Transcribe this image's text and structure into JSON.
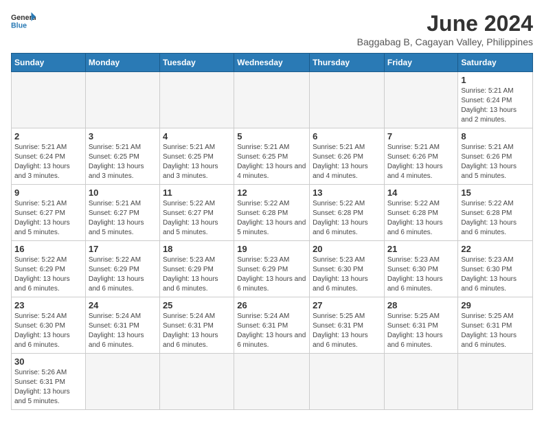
{
  "logo": {
    "text_general": "General",
    "text_blue": "Blue"
  },
  "header": {
    "title": "June 2024",
    "subtitle": "Baggabag B, Cagayan Valley, Philippines"
  },
  "weekdays": [
    "Sunday",
    "Monday",
    "Tuesday",
    "Wednesday",
    "Thursday",
    "Friday",
    "Saturday"
  ],
  "weeks": [
    [
      {
        "day": "",
        "info": "",
        "empty": true
      },
      {
        "day": "",
        "info": "",
        "empty": true
      },
      {
        "day": "",
        "info": "",
        "empty": true
      },
      {
        "day": "",
        "info": "",
        "empty": true
      },
      {
        "day": "",
        "info": "",
        "empty": true
      },
      {
        "day": "",
        "info": "",
        "empty": true
      },
      {
        "day": "1",
        "info": "Sunrise: 5:21 AM\nSunset: 6:24 PM\nDaylight: 13 hours and 2 minutes.",
        "empty": false
      }
    ],
    [
      {
        "day": "2",
        "info": "Sunrise: 5:21 AM\nSunset: 6:24 PM\nDaylight: 13 hours and 3 minutes.",
        "empty": false
      },
      {
        "day": "3",
        "info": "Sunrise: 5:21 AM\nSunset: 6:25 PM\nDaylight: 13 hours and 3 minutes.",
        "empty": false
      },
      {
        "day": "4",
        "info": "Sunrise: 5:21 AM\nSunset: 6:25 PM\nDaylight: 13 hours and 3 minutes.",
        "empty": false
      },
      {
        "day": "5",
        "info": "Sunrise: 5:21 AM\nSunset: 6:25 PM\nDaylight: 13 hours and 4 minutes.",
        "empty": false
      },
      {
        "day": "6",
        "info": "Sunrise: 5:21 AM\nSunset: 6:26 PM\nDaylight: 13 hours and 4 minutes.",
        "empty": false
      },
      {
        "day": "7",
        "info": "Sunrise: 5:21 AM\nSunset: 6:26 PM\nDaylight: 13 hours and 4 minutes.",
        "empty": false
      },
      {
        "day": "8",
        "info": "Sunrise: 5:21 AM\nSunset: 6:26 PM\nDaylight: 13 hours and 5 minutes.",
        "empty": false
      }
    ],
    [
      {
        "day": "9",
        "info": "Sunrise: 5:21 AM\nSunset: 6:27 PM\nDaylight: 13 hours and 5 minutes.",
        "empty": false
      },
      {
        "day": "10",
        "info": "Sunrise: 5:21 AM\nSunset: 6:27 PM\nDaylight: 13 hours and 5 minutes.",
        "empty": false
      },
      {
        "day": "11",
        "info": "Sunrise: 5:22 AM\nSunset: 6:27 PM\nDaylight: 13 hours and 5 minutes.",
        "empty": false
      },
      {
        "day": "12",
        "info": "Sunrise: 5:22 AM\nSunset: 6:28 PM\nDaylight: 13 hours and 5 minutes.",
        "empty": false
      },
      {
        "day": "13",
        "info": "Sunrise: 5:22 AM\nSunset: 6:28 PM\nDaylight: 13 hours and 6 minutes.",
        "empty": false
      },
      {
        "day": "14",
        "info": "Sunrise: 5:22 AM\nSunset: 6:28 PM\nDaylight: 13 hours and 6 minutes.",
        "empty": false
      },
      {
        "day": "15",
        "info": "Sunrise: 5:22 AM\nSunset: 6:28 PM\nDaylight: 13 hours and 6 minutes.",
        "empty": false
      }
    ],
    [
      {
        "day": "16",
        "info": "Sunrise: 5:22 AM\nSunset: 6:29 PM\nDaylight: 13 hours and 6 minutes.",
        "empty": false
      },
      {
        "day": "17",
        "info": "Sunrise: 5:22 AM\nSunset: 6:29 PM\nDaylight: 13 hours and 6 minutes.",
        "empty": false
      },
      {
        "day": "18",
        "info": "Sunrise: 5:23 AM\nSunset: 6:29 PM\nDaylight: 13 hours and 6 minutes.",
        "empty": false
      },
      {
        "day": "19",
        "info": "Sunrise: 5:23 AM\nSunset: 6:29 PM\nDaylight: 13 hours and 6 minutes.",
        "empty": false
      },
      {
        "day": "20",
        "info": "Sunrise: 5:23 AM\nSunset: 6:30 PM\nDaylight: 13 hours and 6 minutes.",
        "empty": false
      },
      {
        "day": "21",
        "info": "Sunrise: 5:23 AM\nSunset: 6:30 PM\nDaylight: 13 hours and 6 minutes.",
        "empty": false
      },
      {
        "day": "22",
        "info": "Sunrise: 5:23 AM\nSunset: 6:30 PM\nDaylight: 13 hours and 6 minutes.",
        "empty": false
      }
    ],
    [
      {
        "day": "23",
        "info": "Sunrise: 5:24 AM\nSunset: 6:30 PM\nDaylight: 13 hours and 6 minutes.",
        "empty": false
      },
      {
        "day": "24",
        "info": "Sunrise: 5:24 AM\nSunset: 6:31 PM\nDaylight: 13 hours and 6 minutes.",
        "empty": false
      },
      {
        "day": "25",
        "info": "Sunrise: 5:24 AM\nSunset: 6:31 PM\nDaylight: 13 hours and 6 minutes.",
        "empty": false
      },
      {
        "day": "26",
        "info": "Sunrise: 5:24 AM\nSunset: 6:31 PM\nDaylight: 13 hours and 6 minutes.",
        "empty": false
      },
      {
        "day": "27",
        "info": "Sunrise: 5:25 AM\nSunset: 6:31 PM\nDaylight: 13 hours and 6 minutes.",
        "empty": false
      },
      {
        "day": "28",
        "info": "Sunrise: 5:25 AM\nSunset: 6:31 PM\nDaylight: 13 hours and 6 minutes.",
        "empty": false
      },
      {
        "day": "29",
        "info": "Sunrise: 5:25 AM\nSunset: 6:31 PM\nDaylight: 13 hours and 6 minutes.",
        "empty": false
      }
    ],
    [
      {
        "day": "30",
        "info": "Sunrise: 5:26 AM\nSunset: 6:31 PM\nDaylight: 13 hours and 5 minutes.",
        "empty": false
      },
      {
        "day": "",
        "info": "",
        "empty": true
      },
      {
        "day": "",
        "info": "",
        "empty": true
      },
      {
        "day": "",
        "info": "",
        "empty": true
      },
      {
        "day": "",
        "info": "",
        "empty": true
      },
      {
        "day": "",
        "info": "",
        "empty": true
      },
      {
        "day": "",
        "info": "",
        "empty": true
      }
    ]
  ]
}
